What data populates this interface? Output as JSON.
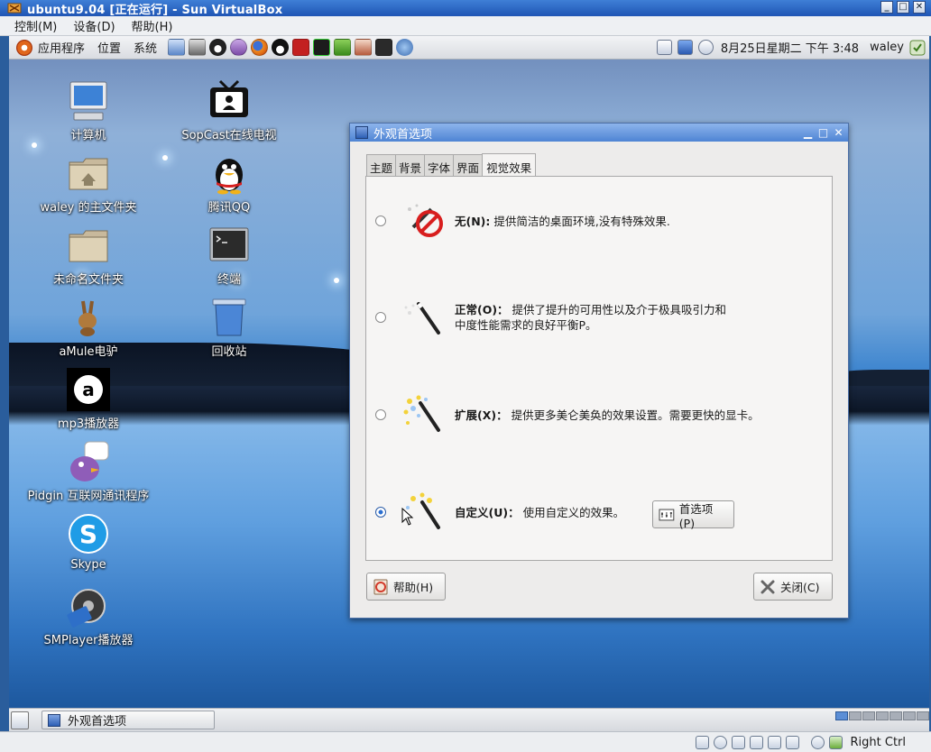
{
  "vbox": {
    "title": "ubuntu9.04 [正在运行] - Sun VirtualBox",
    "menu": [
      "控制(M)",
      "设备(D)",
      "帮助(H)"
    ],
    "host_key": "Right Ctrl"
  },
  "gnome_panel": {
    "menus": [
      "应用程序",
      "位置",
      "系统"
    ],
    "clock": "8月25日星期二 下午 3:48",
    "user": "waley"
  },
  "desktop_icons": [
    {
      "label": "计算机",
      "icon": "computer-icon"
    },
    {
      "label": "waley 的主文件夹",
      "icon": "home-folder-icon"
    },
    {
      "label": "未命名文件夹",
      "icon": "folder-icon"
    },
    {
      "label": "aMule电驴",
      "icon": "amule-icon"
    },
    {
      "label": "mp3播放器",
      "icon": "mp3-player-icon"
    },
    {
      "label": "Pidgin 互联网通讯程序",
      "icon": "pidgin-icon"
    },
    {
      "label": "Skype",
      "icon": "skype-icon"
    },
    {
      "label": "SMPlayer播放器",
      "icon": "smplayer-icon"
    },
    {
      "label": "SopCast在线电视",
      "icon": "sopcast-icon"
    },
    {
      "label": "腾讯QQ",
      "icon": "qq-icon"
    },
    {
      "label": "终端",
      "icon": "terminal-icon"
    },
    {
      "label": "回收站",
      "icon": "trash-icon"
    }
  ],
  "taskbar": {
    "window_label": "外观首选项"
  },
  "dialog": {
    "title": "外观首选项",
    "tabs": [
      "主题",
      "背景",
      "字体",
      "界面",
      "视觉效果"
    ],
    "active_tab": "视觉效果",
    "effects": [
      {
        "title": "无(N):",
        "desc": "提供简洁的桌面环境,没有特殊效果."
      },
      {
        "title": "正常(O)：",
        "desc": "提供了提升的可用性以及介于极具吸引力和",
        "desc2": "中度性能需求的良好平衡P。"
      },
      {
        "title": "扩展(X)：",
        "desc": "提供更多美仑美奂的效果设置。需要更快的显卡。"
      },
      {
        "title": "自定义(U)：",
        "desc": "使用自定义的效果。"
      }
    ],
    "selected_effect": "自定义(U)：",
    "prefs_button": "首选项(P)",
    "help_button": "帮助(H)",
    "close_button": "关闭(C)"
  }
}
